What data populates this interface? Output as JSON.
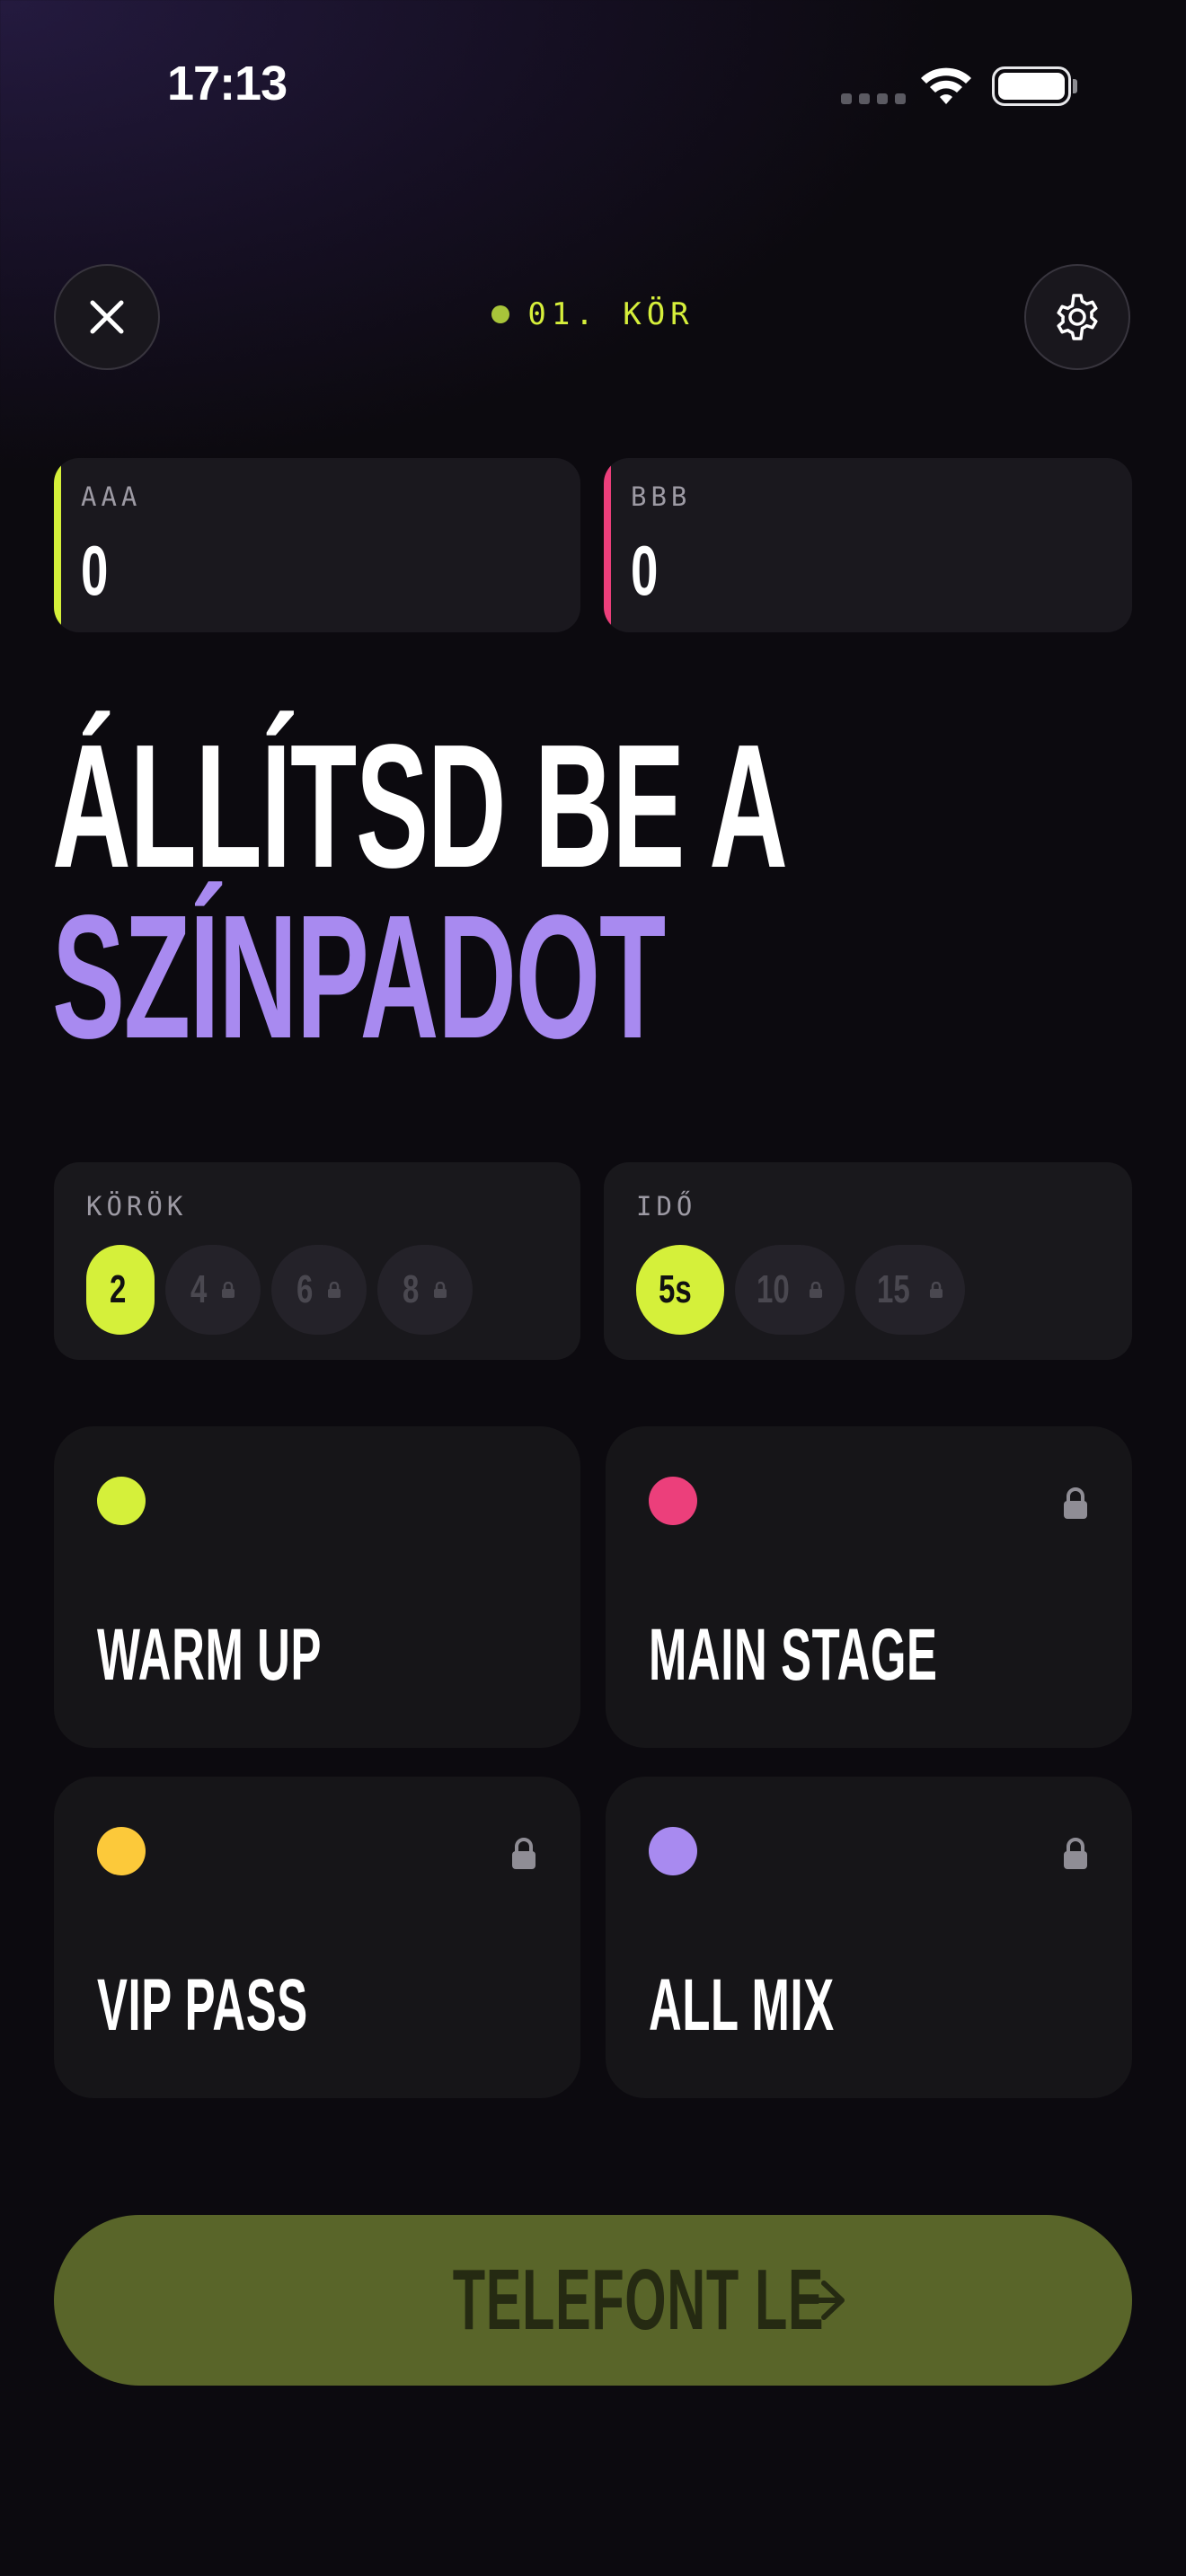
{
  "status_bar": {
    "time": "17:13"
  },
  "header": {
    "round_label": "01. KÖR"
  },
  "scores": [
    {
      "name": "AAA",
      "value": "0",
      "color": "#d5f03a"
    },
    {
      "name": "BBB",
      "value": "0",
      "color": "#ec3f7b"
    }
  ],
  "headline": {
    "line1": "ÁLLÍTSD BE A",
    "line2": "SZÍNPADOT"
  },
  "options": {
    "rounds": {
      "title": "KÖRÖK",
      "chips": [
        "2",
        "4",
        "6",
        "8"
      ],
      "selected": "2"
    },
    "time": {
      "title": "IDŐ",
      "chips": [
        "5s",
        "10",
        "15"
      ],
      "selected": "5s"
    }
  },
  "modes": [
    {
      "label": "WARM UP",
      "color": "#d5f03a",
      "locked": false
    },
    {
      "label": "MAIN STAGE",
      "color": "#ec3f7b",
      "locked": true
    },
    {
      "label": "VIP PASS",
      "color": "#fcc93a",
      "locked": true
    },
    {
      "label": "ALL MIX",
      "color": "#a88af0",
      "locked": true
    }
  ],
  "cta": {
    "label": "TELEFONT LE"
  },
  "colors": {
    "accent": "#d5f03a",
    "purple": "#a88af0",
    "pink": "#ec3f7b"
  }
}
